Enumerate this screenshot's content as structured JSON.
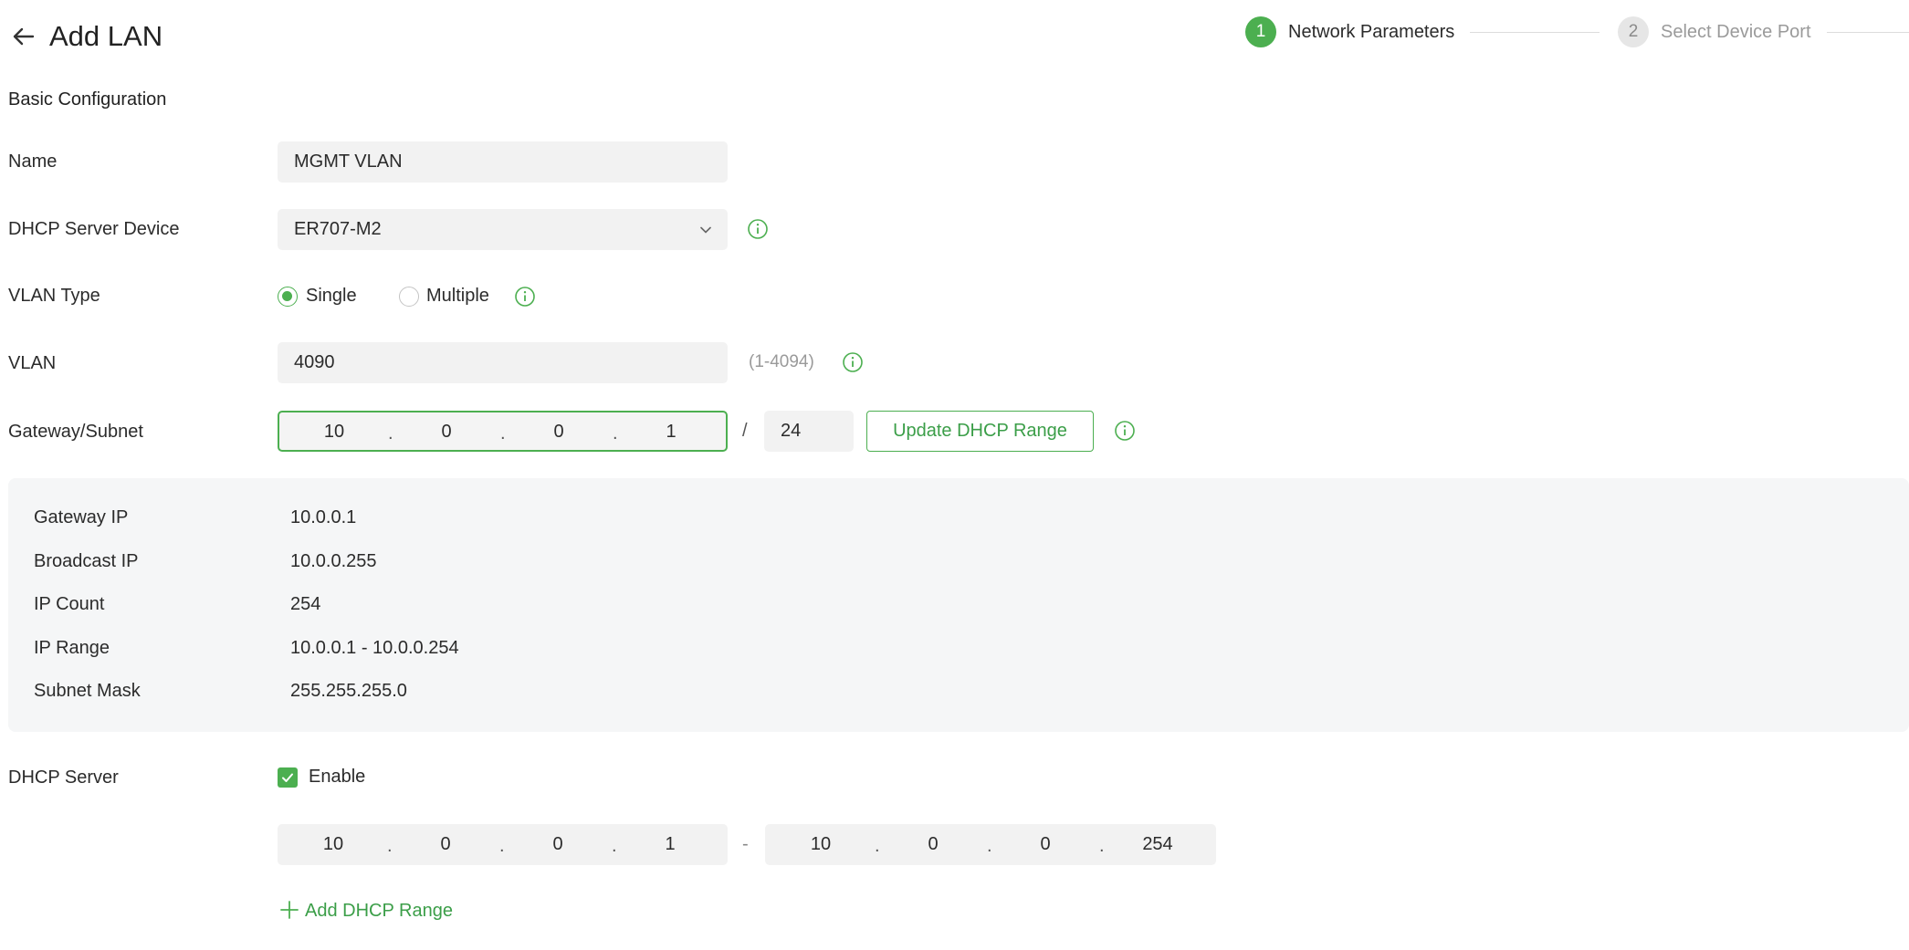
{
  "header": {
    "title": "Add LAN"
  },
  "stepper": {
    "steps": [
      {
        "number": "1",
        "label": "Network Parameters",
        "active": true
      },
      {
        "number": "2",
        "label": "Select Device Port",
        "active": false
      }
    ]
  },
  "section": {
    "title": "Basic Configuration"
  },
  "form": {
    "name": {
      "label": "Name",
      "value": "MGMT VLAN"
    },
    "dhcp_device": {
      "label": "DHCP Server Device",
      "value": "ER707-M2"
    },
    "vlan_type": {
      "label": "VLAN Type",
      "options": [
        "Single",
        "Multiple"
      ],
      "selected": "Single"
    },
    "vlan": {
      "label": "VLAN",
      "value": "4090",
      "hint": "(1-4094)"
    },
    "gateway_subnet": {
      "label": "Gateway/Subnet",
      "octets": [
        "10",
        "0",
        "0",
        "1"
      ],
      "slash": "/",
      "prefix": "24",
      "update_button": "Update DHCP Range"
    }
  },
  "summary": {
    "rows": [
      {
        "label": "Gateway IP",
        "value": "10.0.0.1"
      },
      {
        "label": "Broadcast IP",
        "value": "10.0.0.255"
      },
      {
        "label": "IP Count",
        "value": "254"
      },
      {
        "label": "IP Range",
        "value": "10.0.0.1 - 10.0.0.254"
      },
      {
        "label": "Subnet Mask",
        "value": "255.255.255.0"
      }
    ]
  },
  "dhcp_server": {
    "label": "DHCP Server",
    "enable_label": "Enable",
    "enabled": true,
    "range_start": [
      "10",
      "0",
      "0",
      "1"
    ],
    "range_sep": "-",
    "range_end": [
      "10",
      "0",
      "0",
      "254"
    ],
    "add_range_label": "Add DHCP Range"
  },
  "colors": {
    "accent": "#4caf50",
    "field_bg": "#f2f2f2",
    "summary_bg": "#f5f6f7"
  }
}
